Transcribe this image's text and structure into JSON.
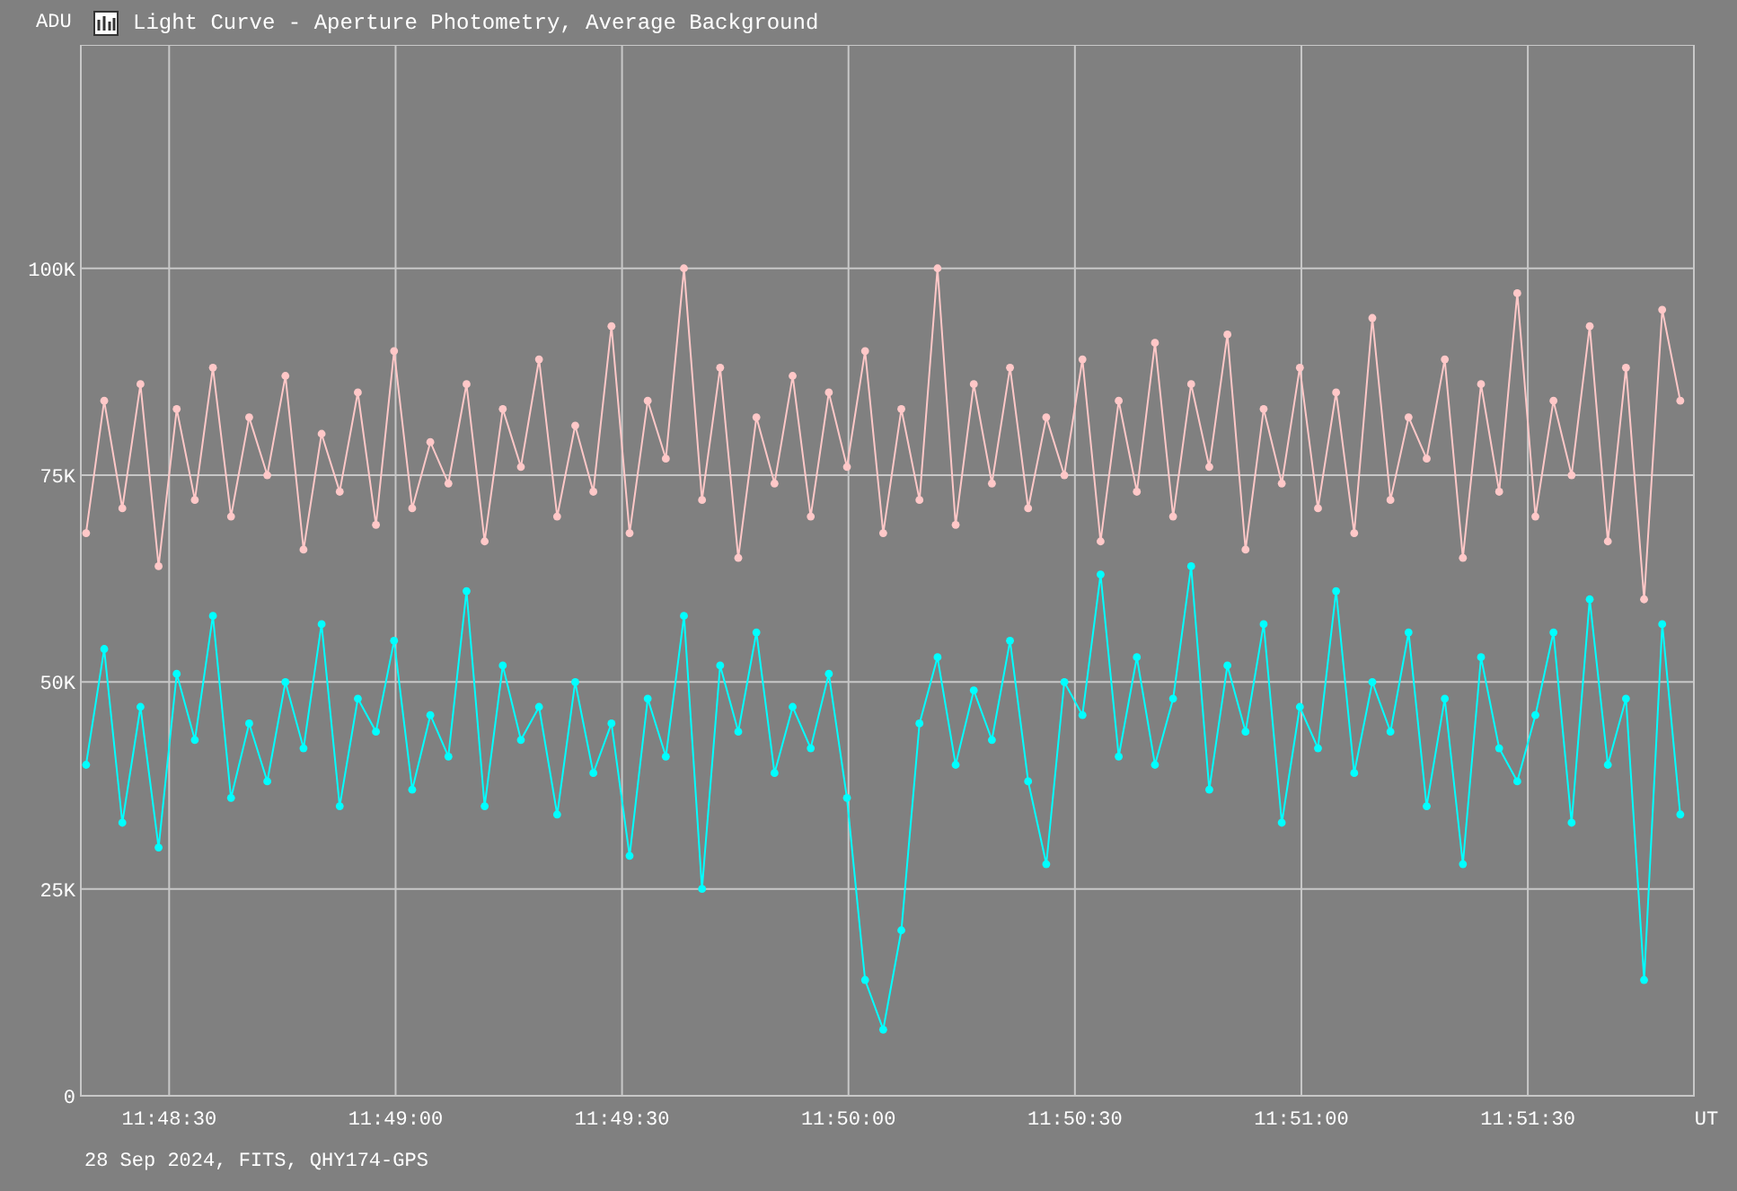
{
  "window": {
    "title": "Light Curve - Aperture Photometry, Average Background"
  },
  "chart": {
    "chart_data": {
      "type": "line",
      "grid": true,
      "ylabel": "ADU",
      "xlabel": "UT",
      "xlim": [
        42498.3,
        42712
      ],
      "ylim": [
        0,
        127000
      ],
      "xticks": [
        {
          "value": 42510,
          "label": "11:48:30"
        },
        {
          "value": 42540,
          "label": "11:49:00"
        },
        {
          "value": 42570,
          "label": "11:49:30"
        },
        {
          "value": 42600,
          "label": "11:50:00"
        },
        {
          "value": 42630,
          "label": "11:50:30"
        },
        {
          "value": 42660,
          "label": "11:51:00"
        },
        {
          "value": 42690,
          "label": "11:51:30"
        }
      ],
      "yticks": [
        {
          "value": 0,
          "label": "0"
        },
        {
          "value": 25000,
          "label": "25K"
        },
        {
          "value": 50000,
          "label": "50K"
        },
        {
          "value": 75000,
          "label": "75K"
        },
        {
          "value": 100000,
          "label": "100K"
        }
      ],
      "x": [
        42499,
        42501.4,
        42503.8,
        42506.2,
        42508.6,
        42511,
        42513.4,
        42515.8,
        42518.2,
        42520.6,
        42523,
        42525.4,
        42527.8,
        42530.2,
        42532.6,
        42535,
        42537.4,
        42539.8,
        42542.2,
        42544.6,
        42547,
        42549.4,
        42551.8,
        42554.2,
        42556.6,
        42559,
        42561.4,
        42563.8,
        42566.2,
        42568.6,
        42571,
        42573.4,
        42575.8,
        42578.2,
        42580.6,
        42583,
        42585.4,
        42587.8,
        42590.2,
        42592.6,
        42595,
        42597.4,
        42599.8,
        42602.2,
        42604.6,
        42607,
        42609.4,
        42611.8,
        42614.2,
        42616.6,
        42619,
        42621.4,
        42623.8,
        42626.2,
        42628.6,
        42631,
        42633.4,
        42635.8,
        42638.2,
        42640.6,
        42643,
        42645.4,
        42647.8,
        42650.2,
        42652.6,
        42655,
        42657.4,
        42659.8,
        42662.2,
        42664.6,
        42667,
        42669.4,
        42671.8,
        42674.2,
        42676.6,
        42679,
        42681.4,
        42683.8,
        42686.2,
        42688.6,
        42691,
        42693.4,
        42695.8,
        42698.2,
        42700.6,
        42703,
        42705.4,
        42707.8,
        42710.2
      ],
      "series": [
        {
          "color": "#ffc8c8",
          "marker": "circle",
          "values": [
            68000,
            84000,
            71000,
            86000,
            64000,
            83000,
            72000,
            88000,
            70000,
            82000,
            75000,
            87000,
            66000,
            80000,
            73000,
            85000,
            69000,
            90000,
            71000,
            79000,
            74000,
            86000,
            67000,
            83000,
            76000,
            89000,
            70000,
            81000,
            73000,
            93000,
            68000,
            84000,
            77000,
            100000,
            72000,
            88000,
            65000,
            82000,
            74000,
            87000,
            70000,
            85000,
            76000,
            90000,
            68000,
            83000,
            72000,
            100000,
            69000,
            86000,
            74000,
            88000,
            71000,
            82000,
            75000,
            89000,
            67000,
            84000,
            73000,
            91000,
            70000,
            86000,
            76000,
            92000,
            66000,
            83000,
            74000,
            88000,
            71000,
            85000,
            68000,
            94000,
            72000,
            82000,
            77000,
            89000,
            65000,
            86000,
            73000,
            97000,
            70000,
            84000,
            75000,
            93000,
            67000,
            88000,
            60000,
            95000,
            84000
          ]
        },
        {
          "color": "#00ffff",
          "marker": "circle",
          "values": [
            40000,
            54000,
            33000,
            47000,
            30000,
            51000,
            43000,
            58000,
            36000,
            45000,
            38000,
            50000,
            42000,
            57000,
            35000,
            48000,
            44000,
            55000,
            37000,
            46000,
            41000,
            61000,
            35000,
            52000,
            43000,
            47000,
            34000,
            50000,
            39000,
            45000,
            29000,
            48000,
            41000,
            58000,
            25000,
            52000,
            44000,
            56000,
            39000,
            47000,
            42000,
            51000,
            36000,
            14000,
            8000,
            20000,
            45000,
            53000,
            40000,
            49000,
            43000,
            55000,
            38000,
            28000,
            50000,
            46000,
            63000,
            41000,
            53000,
            40000,
            48000,
            64000,
            37000,
            52000,
            44000,
            57000,
            33000,
            47000,
            42000,
            61000,
            39000,
            50000,
            44000,
            56000,
            35000,
            48000,
            28000,
            53000,
            42000,
            38000,
            46000,
            56000,
            33000,
            60000,
            40000,
            48000,
            14000,
            57000,
            34000
          ]
        }
      ]
    }
  },
  "status": "28 Sep 2024, FITS, QHY174-GPS"
}
